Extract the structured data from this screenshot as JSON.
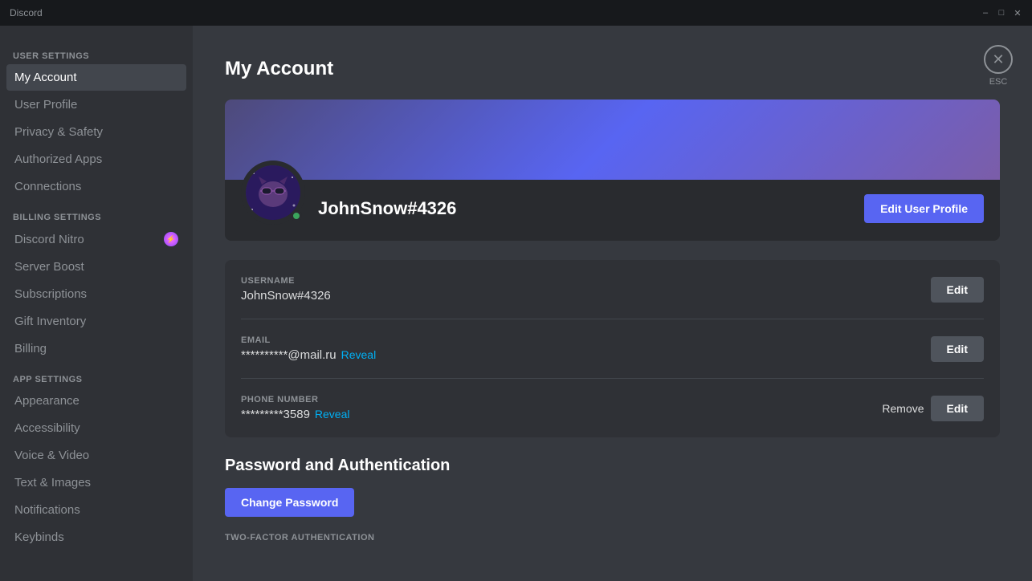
{
  "titlebar": {
    "title": "Discord",
    "minimize": "–",
    "maximize": "□",
    "close": "✕"
  },
  "sidebar": {
    "user_settings_label": "User Settings",
    "items_user": [
      {
        "id": "my-account",
        "label": "My Account",
        "active": true
      },
      {
        "id": "user-profile",
        "label": "User Profile",
        "active": false
      },
      {
        "id": "privacy-safety",
        "label": "Privacy & Safety",
        "active": false
      },
      {
        "id": "authorized-apps",
        "label": "Authorized Apps",
        "active": false
      },
      {
        "id": "connections",
        "label": "Connections",
        "active": false
      }
    ],
    "billing_settings_label": "Billing Settings",
    "items_billing": [
      {
        "id": "discord-nitro",
        "label": "Discord Nitro",
        "has_icon": true
      },
      {
        "id": "server-boost",
        "label": "Server Boost",
        "has_icon": false
      },
      {
        "id": "subscriptions",
        "label": "Subscriptions",
        "has_icon": false
      },
      {
        "id": "gift-inventory",
        "label": "Gift Inventory",
        "has_icon": false
      },
      {
        "id": "billing",
        "label": "Billing",
        "has_icon": false
      }
    ],
    "app_settings_label": "App Settings",
    "items_app": [
      {
        "id": "appearance",
        "label": "Appearance"
      },
      {
        "id": "accessibility",
        "label": "Accessibility"
      },
      {
        "id": "voice-video",
        "label": "Voice & Video"
      },
      {
        "id": "text-images",
        "label": "Text & Images"
      },
      {
        "id": "notifications",
        "label": "Notifications"
      },
      {
        "id": "keybinds",
        "label": "Keybinds"
      }
    ]
  },
  "content": {
    "page_title": "My Account",
    "profile": {
      "username": "JohnSnow#4326",
      "avatar_emoji": "😎",
      "edit_profile_btn": "Edit User Profile"
    },
    "fields": {
      "username": {
        "label": "USERNAME",
        "value": "JohnSnow#4326",
        "edit_btn": "Edit"
      },
      "email": {
        "label": "EMAIL",
        "value": "**********@mail.ru",
        "reveal_link": "Reveal",
        "edit_btn": "Edit"
      },
      "phone": {
        "label": "PHONE NUMBER",
        "value": "*********3589",
        "reveal_link": "Reveal",
        "remove_link": "Remove",
        "edit_btn": "Edit"
      }
    },
    "password_section": {
      "title": "Password and Authentication",
      "change_password_btn": "Change Password",
      "two_fa_label": "TWO-FACTOR AUTHENTICATION"
    },
    "close_btn_label": "✕",
    "esc_label": "ESC"
  }
}
